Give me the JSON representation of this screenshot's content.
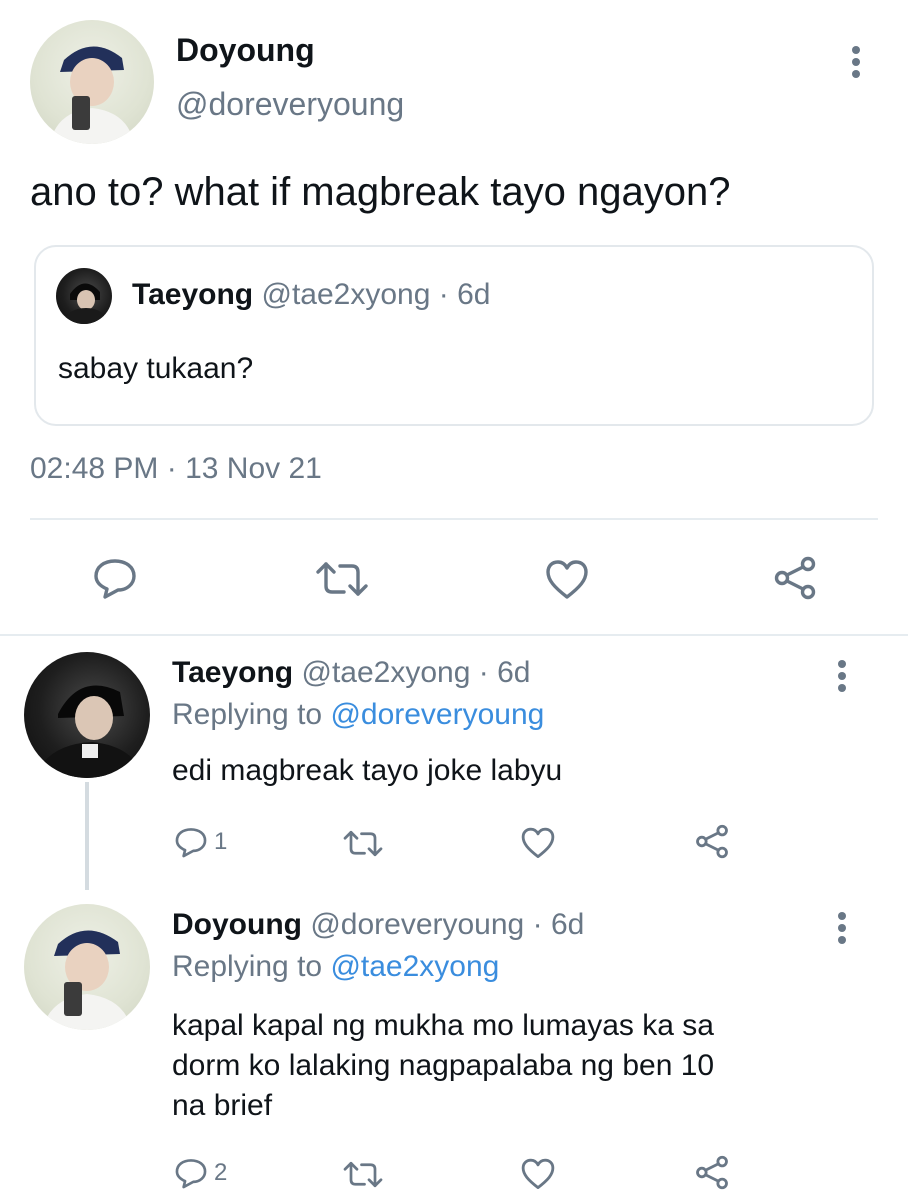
{
  "main_tweet": {
    "author_name": "Doyoung",
    "author_handle": "@doreveryoung",
    "text": "ano to? what if magbreak tayo ngayon?",
    "quoted": {
      "author_name": "Taeyong",
      "author_handle": "@tae2xyong",
      "sep": "·",
      "age": "6d",
      "text": "sabay tukaan?"
    },
    "timestamp": "02:48 PM · 13 Nov 21"
  },
  "replies": [
    {
      "author_name": "Taeyong",
      "author_handle": "@tae2xyong",
      "sep": "·",
      "age": "6d",
      "replying_prefix": "Replying to",
      "replying_handle": "@doreveryoung",
      "text": "edi magbreak tayo joke labyu",
      "reply_count": "1"
    },
    {
      "author_name": "Doyoung",
      "author_handle": "@doreveryoung",
      "sep": "·",
      "age": "6d",
      "replying_prefix": "Replying to",
      "replying_handle": "@tae2xyong",
      "text_line1": "kapal kapal ng mukha mo lumayas ka sa",
      "text_line2": "dorm ko lalaking nagpapalaba ng ben 10",
      "text_line3": "na brief",
      "reply_count": "2"
    }
  ],
  "icons": [
    "more-icon",
    "reply-icon",
    "retweet-icon",
    "like-icon",
    "share-icon"
  ],
  "colors": {
    "text": "#0f1419",
    "muted": "#697786",
    "link": "#3a8dde",
    "border": "#e3e8ec"
  }
}
